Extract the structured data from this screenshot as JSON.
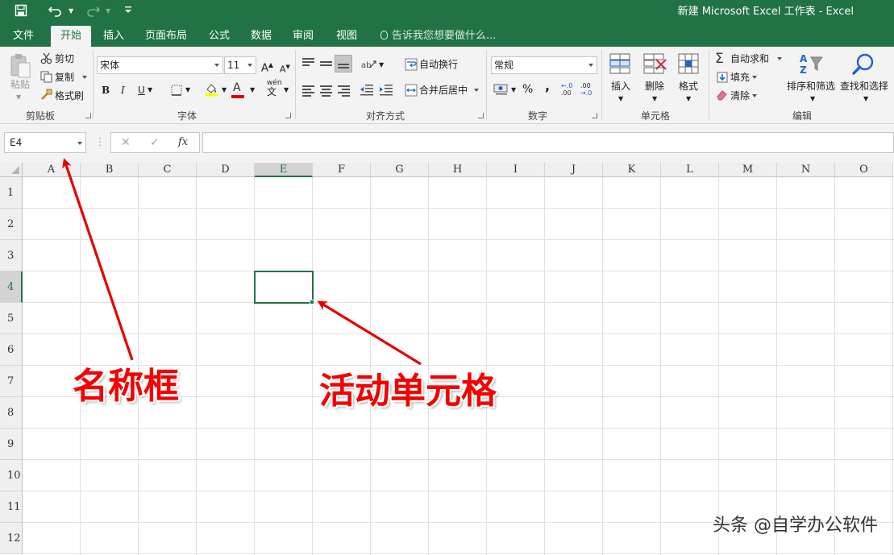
{
  "window": {
    "title": "新建 Microsoft Excel 工作表 - Excel"
  },
  "tabs": [
    {
      "label": "文件",
      "active": false
    },
    {
      "label": "开始",
      "active": true
    },
    {
      "label": "插入",
      "active": false
    },
    {
      "label": "页面布局",
      "active": false
    },
    {
      "label": "公式",
      "active": false
    },
    {
      "label": "数据",
      "active": false
    },
    {
      "label": "审阅",
      "active": false
    },
    {
      "label": "视图",
      "active": false
    }
  ],
  "tell_me": "告诉我您想要做什么...",
  "ribbon": {
    "clipboard": {
      "label": "剪贴板",
      "paste": "粘贴",
      "cut": "剪切",
      "copy": "复制",
      "format_painter": "格式刷"
    },
    "font": {
      "label": "字体",
      "font_name": "宋体",
      "font_size": "11",
      "bold": "B",
      "italic": "I",
      "underline": "U",
      "grow": "A",
      "shrink": "A",
      "font_color_glyph": "A",
      "phonetic": "wén"
    },
    "alignment": {
      "label": "对齐方式",
      "wrap_text": "自动换行",
      "merge_center": "合并后居中"
    },
    "number": {
      "label": "数字",
      "format": "常规",
      "percent": "%",
      "comma": ",",
      "inc_decimal": "←.0 .00",
      "dec_decimal": ".00 →.0"
    },
    "cells": {
      "label": "单元格",
      "insert": "插入",
      "delete": "删除",
      "format": "格式"
    },
    "editing": {
      "label": "编辑",
      "autosum": "自动求和",
      "fill": "填充",
      "clear": "清除",
      "sort_filter": "排序和筛选",
      "find_select": "查找和选择"
    }
  },
  "formula_bar": {
    "name_box": "E4",
    "cancel": "✕",
    "enter": "✓",
    "fx": "fx",
    "value": ""
  },
  "sheet": {
    "columns": [
      "A",
      "B",
      "C",
      "D",
      "E",
      "F",
      "G",
      "H",
      "I",
      "J",
      "K",
      "L",
      "M",
      "N",
      "O"
    ],
    "rows": [
      "1",
      "2",
      "3",
      "4",
      "5",
      "6",
      "7",
      "8",
      "9",
      "10",
      "11",
      "12"
    ],
    "selected_column": "E",
    "selected_row": "4"
  },
  "annotations": {
    "name_box_label": "名称框",
    "active_cell_label": "活动单元格",
    "arrow_color": "#e60000"
  },
  "watermark": "头条 @自学办公软件",
  "colors": {
    "accent": "#217346",
    "ribbon_bg": "#f3f3f3",
    "annotation": "#f40000"
  }
}
